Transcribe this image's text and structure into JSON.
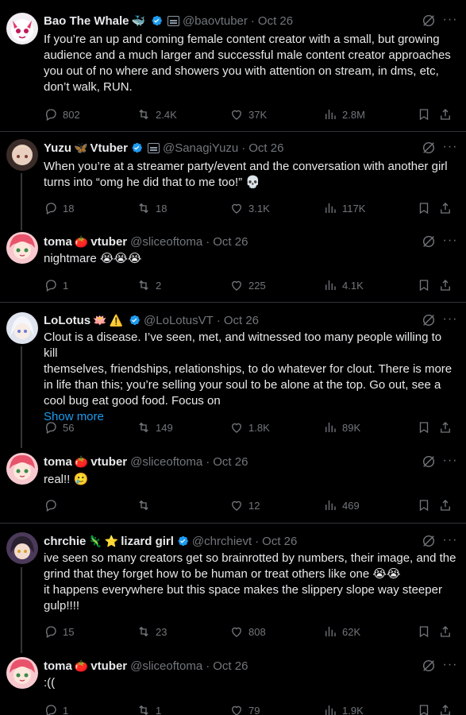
{
  "colors": {
    "background": "#000000",
    "text": "#e7e9ea",
    "muted": "#71767b",
    "link": "#1d9bf0",
    "verified": "#1d9bf0",
    "divider": "#2f3336"
  },
  "tweets": [
    {
      "name": "Bao The Whale",
      "name_emojis": [
        "whale-emoji"
      ],
      "verified": true,
      "affiliate_badge": true,
      "handle": "@baovtuber",
      "separator": "·",
      "date": "Oct 26",
      "lines": [
        "If you’re an up and coming female content creator with a small, but growing",
        "audience and a much larger and successful male content creator approaches",
        "you out of no where and showers you with attention on stream, in dms, etc,",
        "don’t walk, RUN."
      ],
      "stats": {
        "replies": "802",
        "retweets": "2.4K",
        "likes": "37K",
        "views": "2.8M"
      }
    },
    {
      "name": "Yuzu",
      "name_suffix": "Vtuber",
      "name_emojis": [
        "butterfly-emoji"
      ],
      "verified": true,
      "affiliate_badge": true,
      "handle": "@SanagiYuzu",
      "separator": "·",
      "date": "Oct 26",
      "lines": [
        "When you’re at a streamer party/event and the conversation with another girl",
        "turns into “omg he did that to me too!” 💀"
      ],
      "stats": {
        "replies": "18",
        "retweets": "18",
        "likes": "3.1K",
        "views": "117K"
      }
    },
    {
      "name": "toma",
      "name_suffix": "vtuber",
      "name_emojis": [
        "tomato-emoji"
      ],
      "verified": false,
      "handle": "@sliceoftoma",
      "separator": "·",
      "date": "Oct 26",
      "lines": [
        "nightmare 😭😭😭"
      ],
      "stats": {
        "replies": "1",
        "retweets": "2",
        "likes": "225",
        "views": "4.1K"
      }
    },
    {
      "name": "LoLotus",
      "name_emojis": [
        "lotus-emoji",
        "warning-emoji"
      ],
      "verified": true,
      "handle": "@LoLotusVT",
      "separator": "·",
      "date": "Oct 26",
      "lines": [
        "Clout is a disease. I’ve seen, met, and witnessed too many people willing to kill",
        "themselves, friendships, relationships, to do whatever for clout. There is more",
        "in life than this; you’re selling your soul to be alone at the top. Go out, see a",
        "cool bug eat good food. Focus on"
      ],
      "show_more": "Show more",
      "stats": {
        "replies": "56",
        "retweets": "149",
        "likes": "1.8K",
        "views": "89K"
      }
    },
    {
      "name": "toma",
      "name_suffix": "vtuber",
      "name_emojis": [
        "tomato-emoji"
      ],
      "verified": false,
      "handle": "@sliceoftoma",
      "separator": "·",
      "date": "Oct 26",
      "lines": [
        "real!! 🥲"
      ],
      "stats": {
        "replies": "",
        "retweets": "",
        "likes": "12",
        "views": "469"
      }
    },
    {
      "name": "chrchie",
      "name_suffix": "lizard girl",
      "name_emojis": [
        "lizard-emoji",
        "star-emoji"
      ],
      "verified": true,
      "handle": "@chrchievt",
      "separator": "·",
      "date": "Oct 26",
      "lines": [
        "ive seen so many creators get so brainrotted by numbers, their image, and the",
        "grind that they forget how to be human or treat others like one 😭😭",
        "it happens everywhere but this space makes the slippery slope way steeper",
        "gulp!!!!"
      ],
      "stats": {
        "replies": "15",
        "retweets": "23",
        "likes": "808",
        "views": "62K"
      }
    },
    {
      "name": "toma",
      "name_suffix": "vtuber",
      "name_emojis": [
        "tomato-emoji"
      ],
      "verified": false,
      "handle": "@sliceoftoma",
      "separator": "·",
      "date": "Oct 26",
      "lines": [
        ":(("
      ],
      "stats": {
        "replies": "1",
        "retweets": "1",
        "likes": "79",
        "views": "1.9K"
      }
    }
  ]
}
